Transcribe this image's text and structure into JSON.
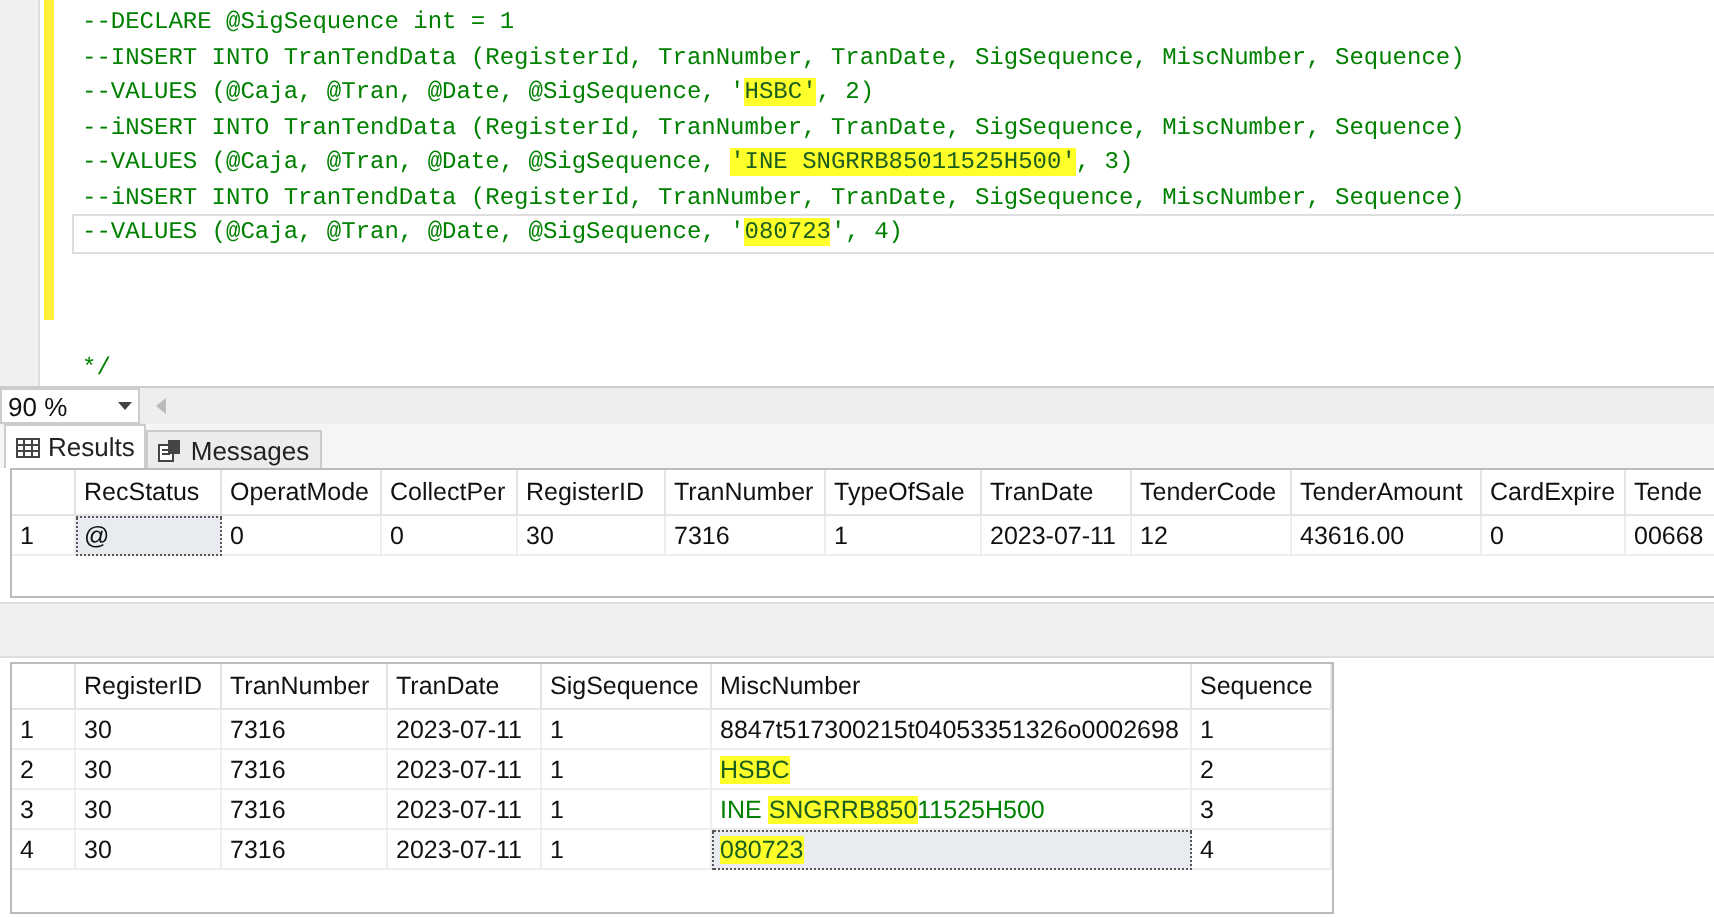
{
  "editor": {
    "lines": [
      {
        "segments": [
          {
            "text": "--DECLARE @SigSequence int = 1",
            "highlighted": false
          }
        ]
      },
      {
        "segments": [
          {
            "text": "--INSERT INTO TranTendData (RegisterId, TranNumber, TranDate, SigSequence, MiscNumber, Sequence)",
            "highlighted": false
          }
        ]
      },
      {
        "segments": [
          {
            "text": "--VALUES (@Caja, @Tran, @Date, @SigSequence, '",
            "highlighted": false
          },
          {
            "text": "HSBC'",
            "highlighted": true
          },
          {
            "text": ", 2)",
            "highlighted": false
          }
        ]
      },
      {
        "segments": [
          {
            "text": "--iNSERT INTO TranTendData (RegisterId, TranNumber, TranDate, SigSequence, MiscNumber, Sequence)",
            "highlighted": false
          }
        ]
      },
      {
        "segments": [
          {
            "text": "--VALUES (@Caja, @Tran, @Date, @SigSequence, ",
            "highlighted": false
          },
          {
            "text": "'INE SNGRRB85011525H500'",
            "highlighted": true
          },
          {
            "text": ", 3)",
            "highlighted": false
          }
        ]
      },
      {
        "segments": [
          {
            "text": "--iNSERT INTO TranTendData (RegisterId, TranNumber, TranDate, SigSequence, MiscNumber, Sequence)",
            "highlighted": false
          }
        ]
      },
      {
        "segments": [
          {
            "text": "--VALUES (@Caja, @Tran, @Date, @SigSequence, '",
            "highlighted": false
          },
          {
            "text": "080723",
            "highlighted": true
          },
          {
            "text": "', 4)",
            "highlighted": false
          }
        ],
        "current": true
      },
      {
        "segments": [
          {
            "text": "*/",
            "highlighted": false
          }
        ]
      }
    ]
  },
  "zoom": {
    "value": "90 %"
  },
  "tabs": [
    {
      "label": "Results",
      "selected": true,
      "kind": "grid"
    },
    {
      "label": "Messages",
      "selected": false,
      "kind": "messages"
    }
  ],
  "grids": [
    {
      "columns": [
        "RecStatus",
        "OperatMode",
        "CollectPer",
        "RegisterID",
        "TranNumber",
        "TypeOfSale",
        "TranDate",
        "TenderCode",
        "TenderAmount",
        "CardExpire",
        "Tende"
      ],
      "rows": [
        {
          "number": "1",
          "cells": [
            {
              "text": "@",
              "selected": true
            },
            {
              "text": "0",
              "selected": false
            },
            {
              "text": "0",
              "selected": false
            },
            {
              "text": "30",
              "selected": false
            },
            {
              "text": "7316",
              "selected": false
            },
            {
              "text": "1",
              "selected": false
            },
            {
              "text": "2023-07-11",
              "selected": false
            },
            {
              "text": "12",
              "selected": false
            },
            {
              "text": "43616.00",
              "selected": false
            },
            {
              "text": "0",
              "selected": false
            },
            {
              "text": "00668",
              "selected": false
            }
          ]
        }
      ]
    },
    {
      "columns": [
        "RegisterID",
        "TranNumber",
        "TranDate",
        "SigSequence",
        "MiscNumber",
        "Sequence"
      ],
      "rows": [
        {
          "number": "1",
          "cells": [
            {
              "text": "30",
              "selected": false
            },
            {
              "text": "7316",
              "selected": false
            },
            {
              "text": "2023-07-11",
              "selected": false
            },
            {
              "text": "1",
              "selected": false
            },
            {
              "text": "8847t517300215t04053351326o0002698",
              "selected": false
            },
            {
              "text": "1",
              "selected": false
            }
          ]
        },
        {
          "number": "2",
          "cells": [
            {
              "text": "30",
              "selected": false
            },
            {
              "text": "7316",
              "selected": false
            },
            {
              "text": "2023-07-11",
              "selected": false
            },
            {
              "text": "1",
              "selected": false
            },
            {
              "segments": [
                {
                  "text": "HSBC",
                  "highlighted": true
                }
              ],
              "selected": false
            },
            {
              "text": "2",
              "selected": false
            }
          ]
        },
        {
          "number": "3",
          "cells": [
            {
              "text": "30",
              "selected": false
            },
            {
              "text": "7316",
              "selected": false
            },
            {
              "text": "2023-07-11",
              "selected": false
            },
            {
              "text": "1",
              "selected": false
            },
            {
              "segments": [
                {
                  "text": "INE ",
                  "highlighted": false
                },
                {
                  "text": "SNGRRB850",
                  "highlighted": true
                },
                {
                  "text": "11525H500",
                  "highlighted": false
                }
              ],
              "selected": false
            },
            {
              "text": "3",
              "selected": false
            }
          ]
        },
        {
          "number": "4",
          "cells": [
            {
              "text": "30",
              "selected": false
            },
            {
              "text": "7316",
              "selected": false
            },
            {
              "text": "2023-07-11",
              "selected": false
            },
            {
              "text": "1",
              "selected": false
            },
            {
              "segments": [
                {
                  "text": "080723",
                  "highlighted": true
                }
              ],
              "selected": true
            },
            {
              "text": "4",
              "selected": false
            }
          ]
        }
      ]
    }
  ]
}
